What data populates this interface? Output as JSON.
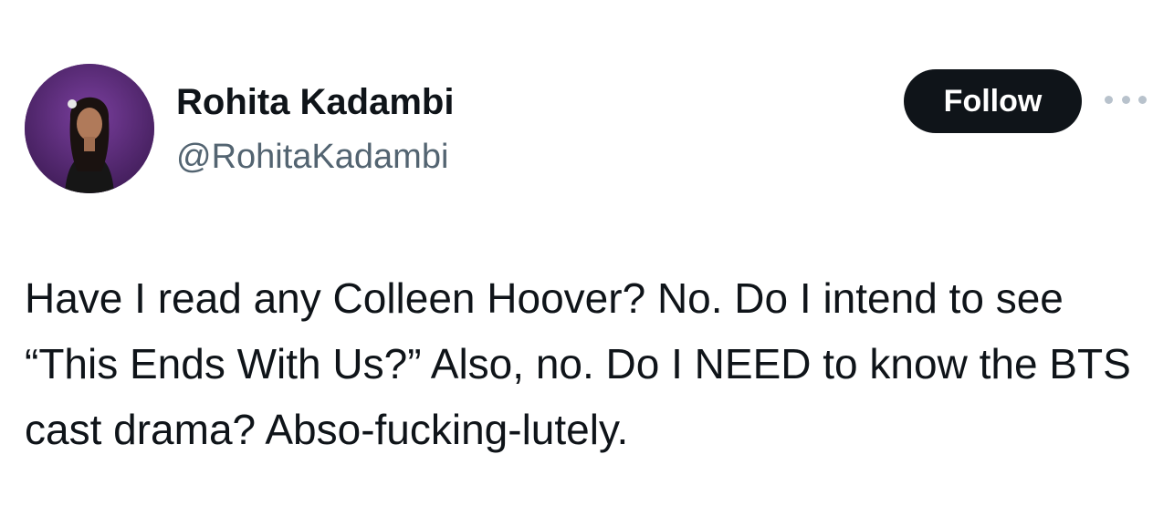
{
  "colors": {
    "text_primary": "#0f1419",
    "text_secondary": "#536471",
    "follow_button_bg": "#0f1419",
    "follow_button_text": "#ffffff",
    "avatar_bg": "#5b2d78"
  },
  "author": {
    "display_name": "Rohita Kadambi",
    "handle": "@RohitaKadambi",
    "avatar_icon": "profile-photo"
  },
  "actions": {
    "follow_label": "Follow",
    "more_icon": "more-horizontal-icon"
  },
  "tweet": {
    "text": "Have I read any Colleen Hoover? No. Do I intend to see “This Ends With Us?” Also, no. Do I NEED to know the BTS cast drama? Abso-fucking-lutely."
  }
}
